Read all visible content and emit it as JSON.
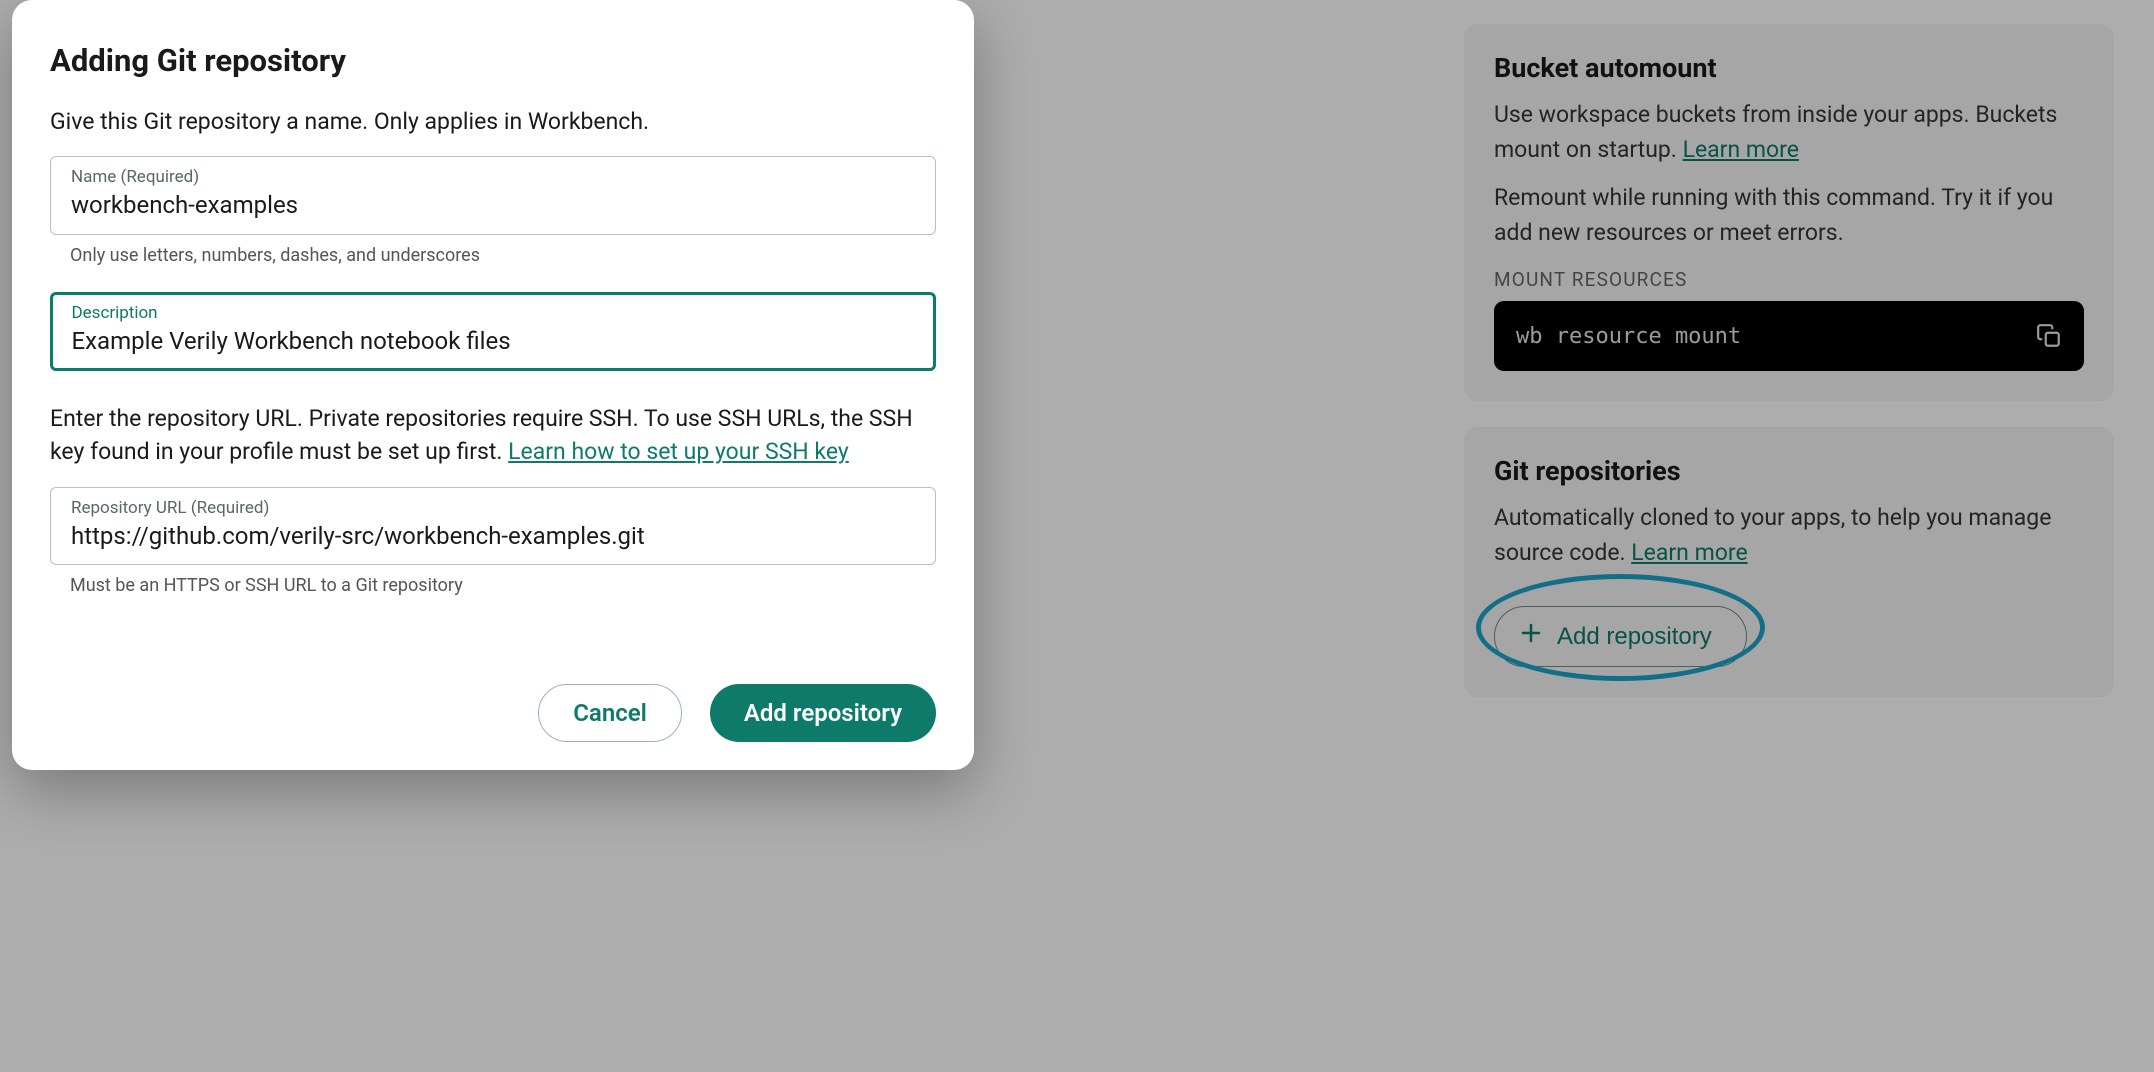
{
  "modal": {
    "title": "Adding Git repository",
    "intro": "Give this Git repository a name. Only applies in Workbench.",
    "name_field": {
      "label": "Name (Required)",
      "value": "workbench-examples",
      "helper": "Only use letters, numbers, dashes, and underscores"
    },
    "description_field": {
      "label": "Description",
      "value": "Example Verily Workbench notebook files"
    },
    "url_intro_pre": "Enter the repository URL. Private repositories require SSH. To use SSH URLs, the SSH key found in your profile must be set up first. ",
    "url_intro_link": "Learn how to set up your SSH key",
    "url_field": {
      "label": "Repository URL (Required)",
      "value": "https://github.com/verily-src/workbench-examples.git",
      "helper": "Must be an HTTPS or SSH URL to a Git repository"
    },
    "cancel_label": "Cancel",
    "submit_label": "Add repository"
  },
  "sidebar": {
    "bucket": {
      "heading": "Bucket automount",
      "p1_pre": "Use workspace buckets from inside your apps. Buckets mount on startup. ",
      "p1_link": "Learn more",
      "p2": "Remount while running with this command. Try it if you add new resources or meet errors.",
      "section_label": "MOUNT RESOURCES",
      "command": "wb resource mount"
    },
    "git": {
      "heading": "Git repositories",
      "p1_pre": "Automatically cloned to your apps, to help you manage source code. ",
      "p1_link": "Learn more",
      "add_label": "Add repository"
    }
  }
}
